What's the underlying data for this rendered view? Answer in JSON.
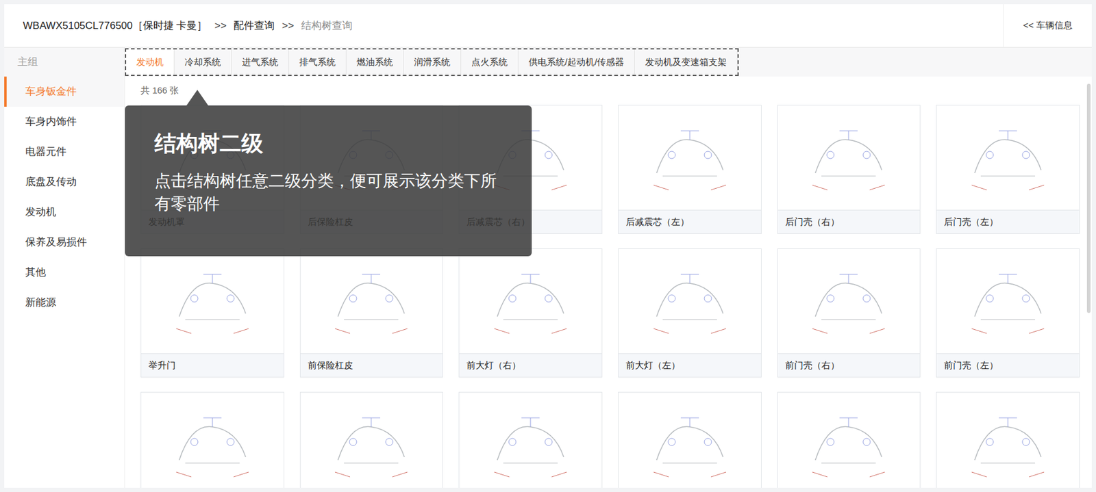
{
  "header": {
    "breadcrumbs": [
      {
        "label": "WBAWX5105CL776500［保时捷 卡曼］",
        "current": false
      },
      {
        "label": "配件查询",
        "current": false
      },
      {
        "label": "结构树查询",
        "current": true
      }
    ],
    "separator": ">>",
    "back_button": "<< 车辆信息"
  },
  "sidebar": {
    "title": "主组",
    "items": [
      {
        "label": "车身钣金件",
        "selected": true
      },
      {
        "label": "车身内饰件",
        "selected": false
      },
      {
        "label": "电器元件",
        "selected": false
      },
      {
        "label": "底盘及传动",
        "selected": false
      },
      {
        "label": "发动机",
        "selected": false
      },
      {
        "label": "保养及易损件",
        "selected": false
      },
      {
        "label": "其他",
        "selected": false
      },
      {
        "label": "新能源",
        "selected": false
      }
    ]
  },
  "tabs": [
    {
      "label": "发动机",
      "selected": true
    },
    {
      "label": "冷却系统",
      "selected": false
    },
    {
      "label": "进气系统",
      "selected": false
    },
    {
      "label": "排气系统",
      "selected": false
    },
    {
      "label": "燃油系统",
      "selected": false
    },
    {
      "label": "润滑系统",
      "selected": false
    },
    {
      "label": "点火系统",
      "selected": false
    },
    {
      "label": "供电系统/起动机/传感器",
      "selected": false
    },
    {
      "label": "发动机及变速箱支架",
      "selected": false
    }
  ],
  "count": "共 166 张",
  "cards": [
    {
      "label": "发动机罩"
    },
    {
      "label": "后保险杠皮"
    },
    {
      "label": "后减震芯（右）"
    },
    {
      "label": "后减震芯（左）"
    },
    {
      "label": "后门壳（右）"
    },
    {
      "label": "后门壳（左）"
    },
    {
      "label": "举升门"
    },
    {
      "label": "前保险杠皮"
    },
    {
      "label": "前大灯（右）"
    },
    {
      "label": "前大灯（左）"
    },
    {
      "label": "前门壳（右）"
    },
    {
      "label": "前门壳（左）"
    },
    {},
    {},
    {},
    {},
    {},
    {}
  ],
  "tooltip": {
    "title": "结构树二级",
    "body": "点击结构树任意二级分类，便可展示该分类下所有零部件"
  }
}
